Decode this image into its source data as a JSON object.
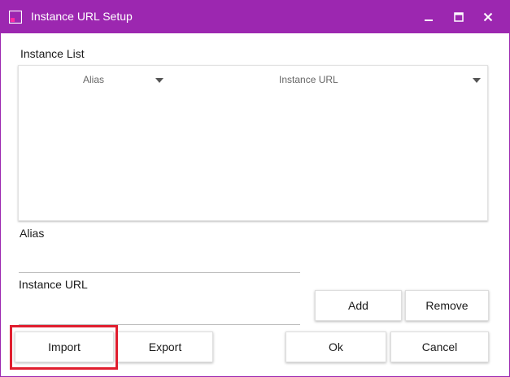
{
  "window": {
    "title": "Instance URL Setup",
    "accent_color": "#9c27b0",
    "controls": [
      "minimize-icon",
      "maximize-icon",
      "close-icon"
    ]
  },
  "instance_list": {
    "label": "Instance List",
    "columns": [
      {
        "header": "Alias"
      },
      {
        "header": "Instance URL"
      }
    ],
    "rows": []
  },
  "alias_field": {
    "label": "Alias",
    "value": ""
  },
  "url_field": {
    "label": "Instance URL",
    "value": ""
  },
  "buttons": {
    "add": "Add",
    "remove": "Remove",
    "import": "Import",
    "export": "Export",
    "ok": "Ok",
    "cancel": "Cancel"
  },
  "highlight_color": "#e01e2e"
}
